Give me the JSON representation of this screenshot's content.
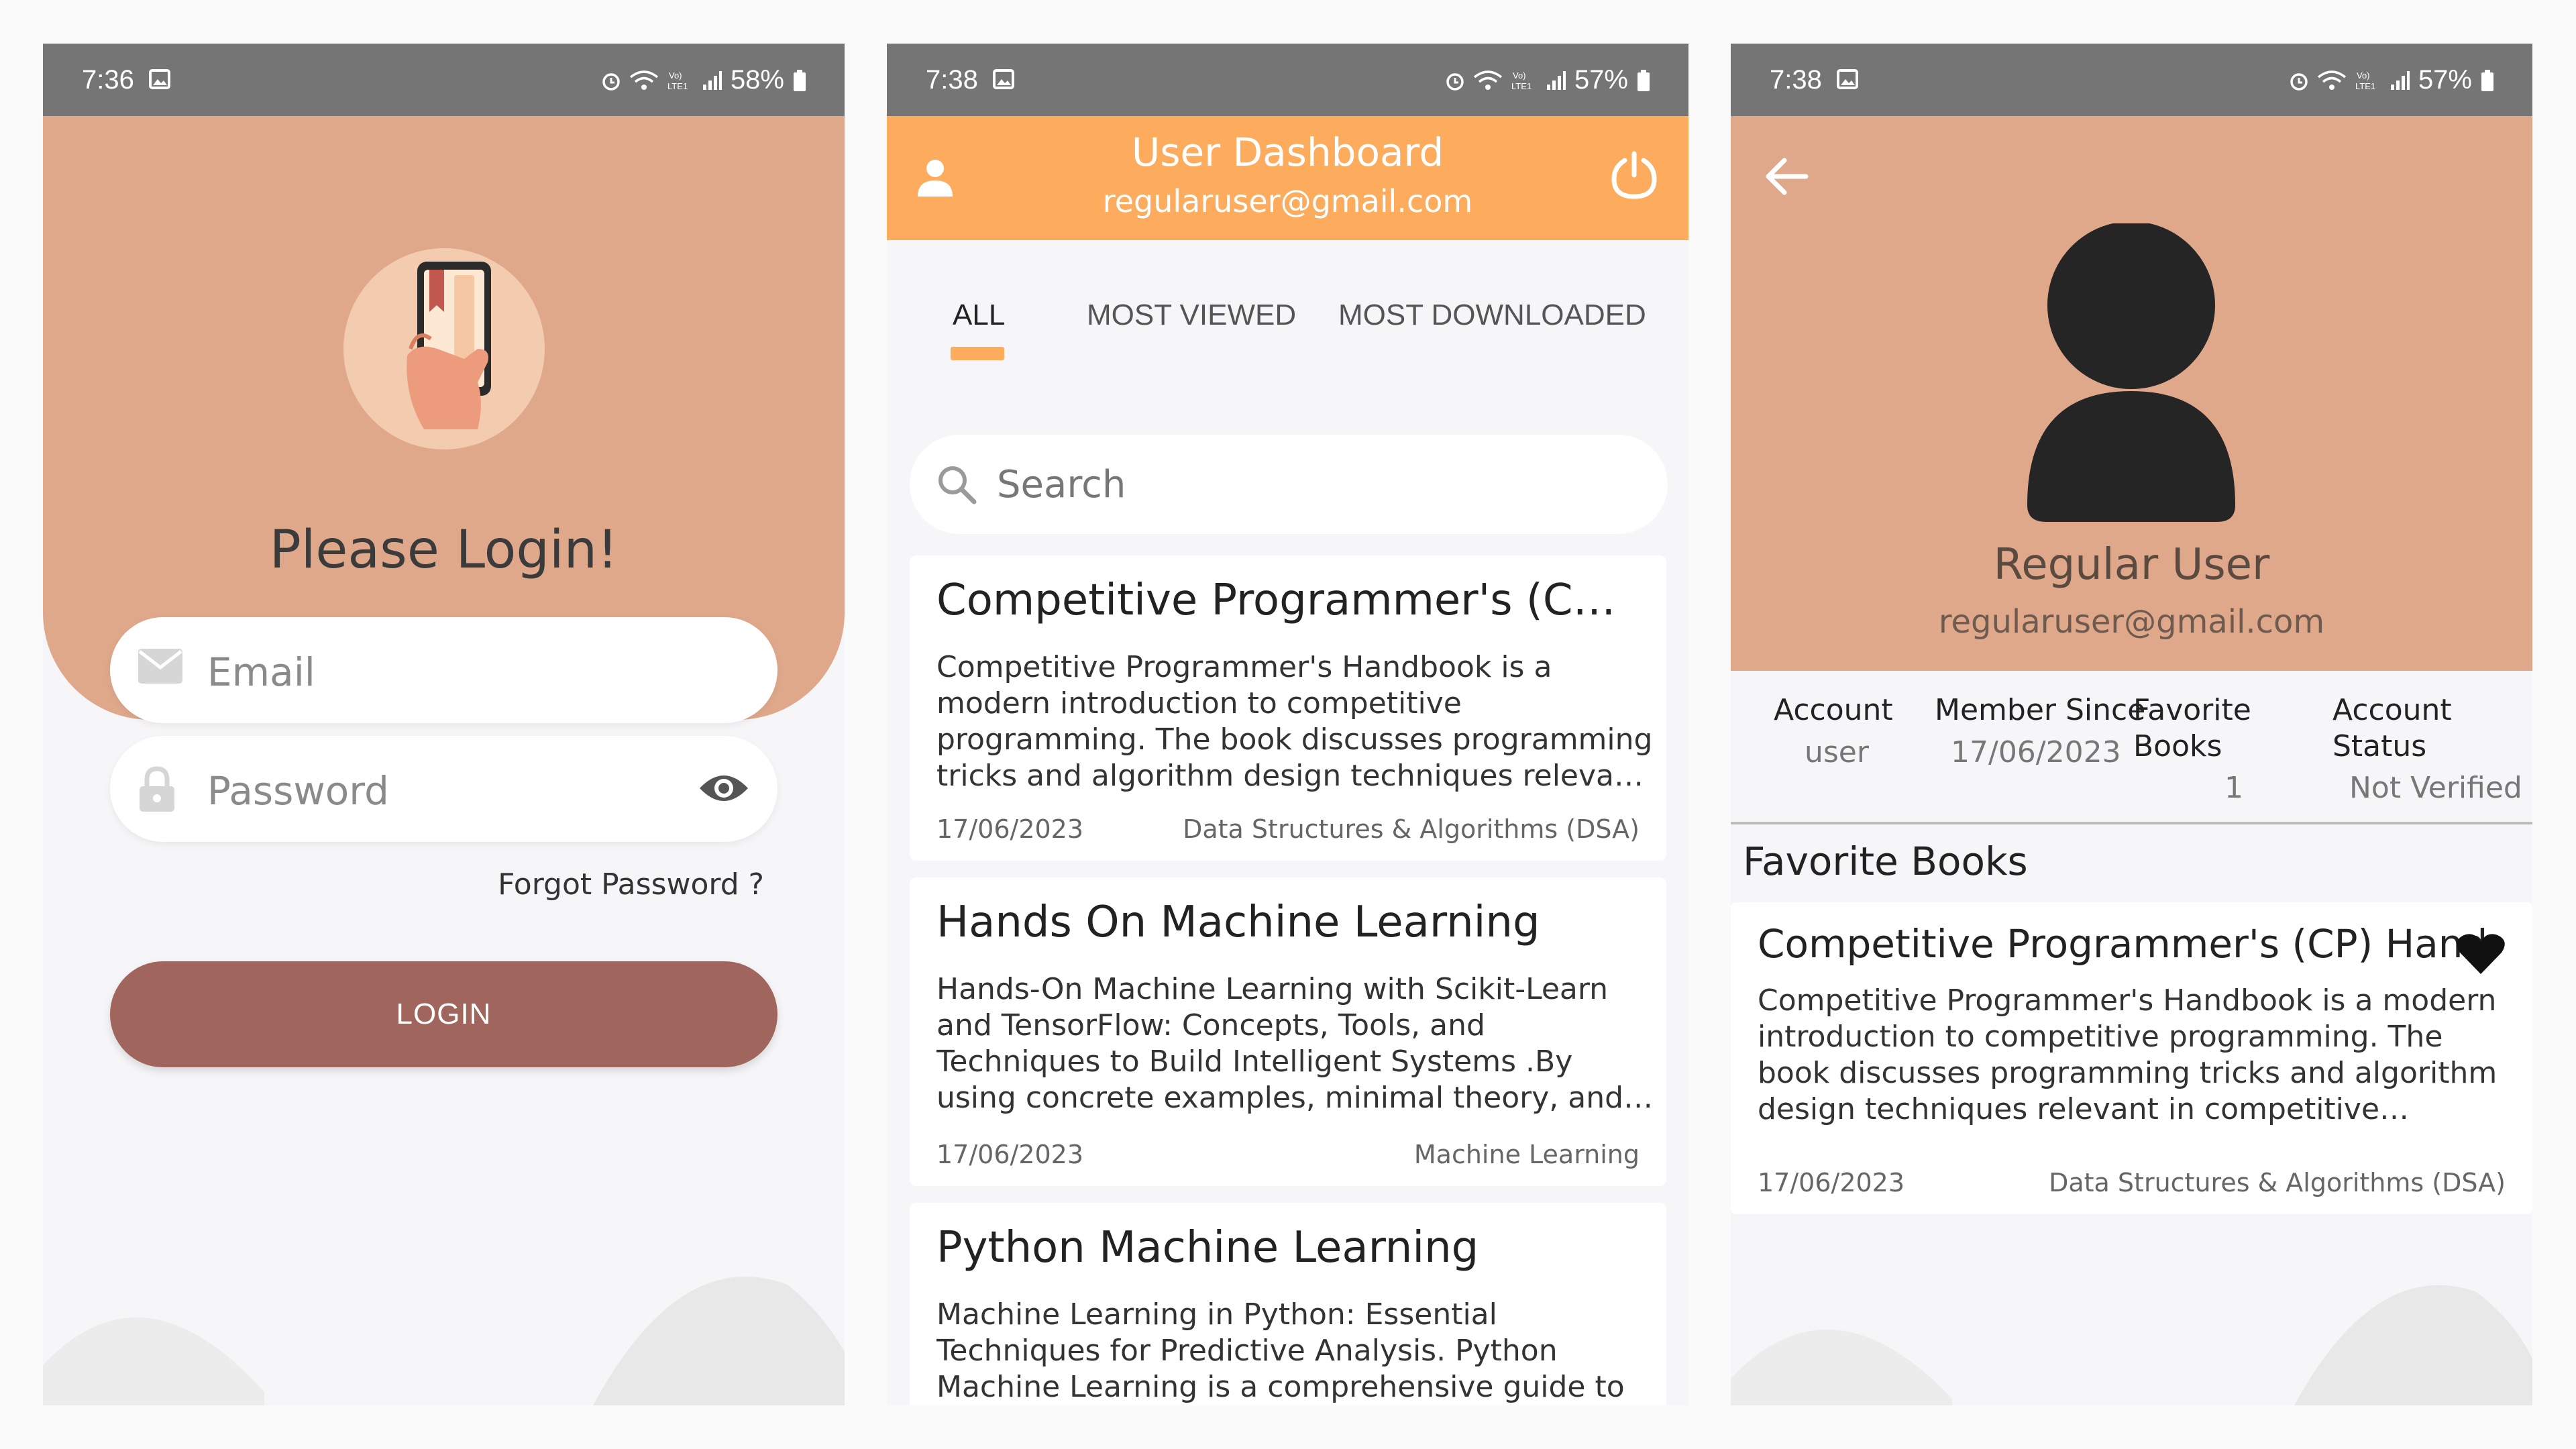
{
  "login": {
    "status_time": "7:36",
    "battery": "58%",
    "title": "Please Login!",
    "email_placeholder": "Email",
    "password_placeholder": "Password",
    "forgot": "Forgot Password ?",
    "login_button": "LOGIN"
  },
  "dashboard": {
    "status_time": "7:38",
    "battery": "57%",
    "title": "User Dashboard",
    "email": "regularuser@gmail.com",
    "tabs": [
      "ALL",
      "MOST VIEWED",
      "MOST DOWNLOADED"
    ],
    "search_placeholder": "Search",
    "books": [
      {
        "title": "Competitive Programmer's (CP) H...",
        "desc": "Competitive Programmer's Handbook is a modern introduction to competitive programming. The book discusses programming tricks and algorithm design techniques relevant in competitive progr...",
        "date": "17/06/2023",
        "category": "Data Structures & Algorithms (DSA)"
      },
      {
        "title": "Hands On Machine Learning",
        "desc": "Hands-On Machine Learning with Scikit-Learn and TensorFlow: Concepts, Tools, and Techniques to Build Intelligent Systems .By using concrete examples, minimal theory, and t...",
        "date": "17/06/2023",
        "category": "Machine Learning"
      },
      {
        "title": "Python Machine Learning",
        "desc": "Machine Learning in Python: Essential Techniques for Predictive Analysis. Python Machine Learning is a comprehensive guide to machine learning and deep learning with Python. It acts as both a ..."
      }
    ]
  },
  "profile": {
    "status_time": "7:38",
    "battery": "57%",
    "name": "Regular User",
    "email": "regularuser@gmail.com",
    "stats": {
      "account_label": "Account",
      "account_value": "user",
      "member_label": "Member Since",
      "member_value": "17/06/2023",
      "favorite_label_1": "Favorite",
      "favorite_label_2": "Books",
      "favorite_value": "1",
      "status_label_1": "Account",
      "status_label_2": "Status",
      "status_value": "Not Verified"
    },
    "favorites_heading": "Favorite Books",
    "favorite_book": {
      "title": "Competitive Programmer's (CP) Handbook",
      "desc": "Competitive Programmer's Handbook is a modern introduction to competitive programming. The book discusses programming tricks and algorithm design techniques relevant in competitive programming. T...",
      "date": "17/06/2023",
      "category": "Data Structures & Algorithms (DSA)"
    }
  },
  "colors": {
    "status_bar": "#757575",
    "login_header": "#dfa88b",
    "login_button": "#a0655c",
    "dashboard_header": "#fcac5c",
    "profile_header": "#dfa88b"
  }
}
